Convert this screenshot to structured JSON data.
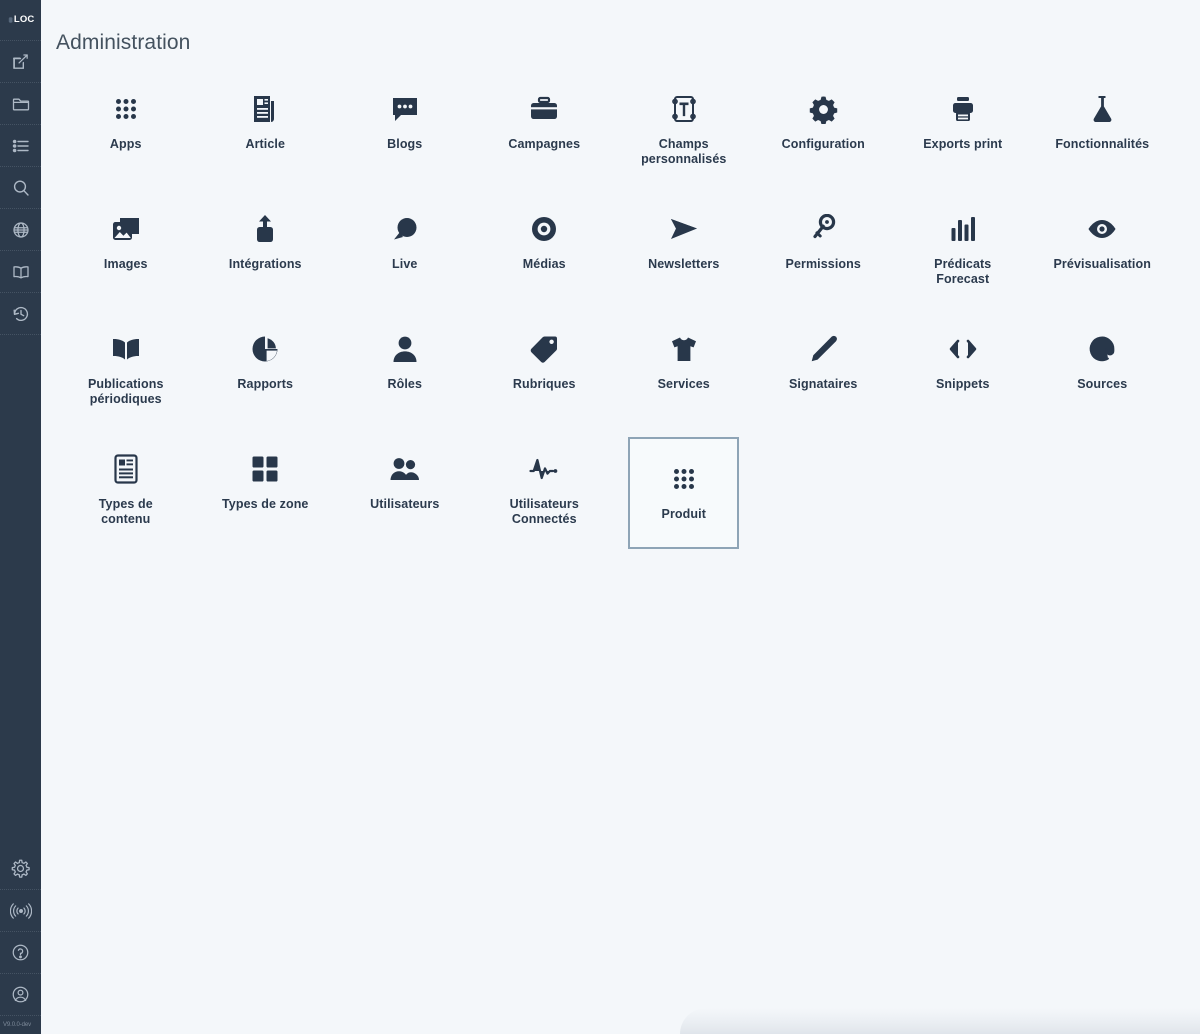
{
  "app": {
    "logo_text": "LOC",
    "version": "V9.0.0-dev"
  },
  "sidebar": {
    "items": [
      {
        "icon": "compose-icon",
        "name": "sidebar-item-compose"
      },
      {
        "icon": "folder-icon",
        "name": "sidebar-item-folder"
      },
      {
        "icon": "list-icon",
        "name": "sidebar-item-list"
      },
      {
        "icon": "search-icon",
        "name": "sidebar-item-search"
      },
      {
        "icon": "globe-icon",
        "name": "sidebar-item-globe"
      },
      {
        "icon": "book-icon",
        "name": "sidebar-item-book"
      },
      {
        "icon": "history-icon",
        "name": "sidebar-item-history"
      }
    ],
    "bottom_items": [
      {
        "icon": "gear-icon",
        "name": "sidebar-item-settings"
      },
      {
        "icon": "broadcast-icon",
        "name": "sidebar-item-broadcast"
      },
      {
        "icon": "help-icon",
        "name": "sidebar-item-help"
      },
      {
        "icon": "account-icon",
        "name": "sidebar-item-account"
      }
    ]
  },
  "page": {
    "title": "Administration"
  },
  "colors": {
    "sidebar_bg": "#2c3a4b",
    "main_bg": "#f4f7fa",
    "icon_dark": "#28374a",
    "label": "#2b3a4d",
    "title": "#44525f",
    "selected_border": "#8ea4b6"
  },
  "tiles": [
    {
      "label": "Apps",
      "icon": "apps-grid-icon",
      "selected": false
    },
    {
      "label": "Article",
      "icon": "article-icon",
      "selected": false
    },
    {
      "label": "Blogs",
      "icon": "chat-bubble-icon",
      "selected": false
    },
    {
      "label": "Campagnes",
      "icon": "briefcase-icon",
      "selected": false
    },
    {
      "label": "Champs\npersonnalisés",
      "icon": "text-field-icon",
      "selected": false
    },
    {
      "label": "Configuration",
      "icon": "gear-icon",
      "selected": false
    },
    {
      "label": "Exports print",
      "icon": "printer-icon",
      "selected": false
    },
    {
      "label": "Fonctionnalités",
      "icon": "flask-icon",
      "selected": false
    },
    {
      "label": "Images",
      "icon": "images-icon",
      "selected": false
    },
    {
      "label": "Intégrations",
      "icon": "upload-box-icon",
      "selected": false
    },
    {
      "label": "Live",
      "icon": "speech-bubble-icon",
      "selected": false
    },
    {
      "label": "Médias",
      "icon": "record-circle-icon",
      "selected": false
    },
    {
      "label": "Newsletters",
      "icon": "send-arrow-icon",
      "selected": false
    },
    {
      "label": "Permissions",
      "icon": "key-icon",
      "selected": false
    },
    {
      "label": "Prédicats\nForecast",
      "icon": "bar-chart-icon",
      "selected": false
    },
    {
      "label": "Prévisualisation",
      "icon": "eye-icon",
      "selected": false
    },
    {
      "label": "Publications\npériodiques",
      "icon": "open-book-icon",
      "selected": false
    },
    {
      "label": "Rapports",
      "icon": "pie-chart-icon",
      "selected": false
    },
    {
      "label": "Rôles",
      "icon": "person-icon",
      "selected": false
    },
    {
      "label": "Rubriques",
      "icon": "tag-icon",
      "selected": false
    },
    {
      "label": "Services",
      "icon": "tshirt-icon",
      "selected": false
    },
    {
      "label": "Signataires",
      "icon": "pencil-icon",
      "selected": false
    },
    {
      "label": "Snippets",
      "icon": "code-brackets-icon",
      "selected": false
    },
    {
      "label": "Sources",
      "icon": "at-sign-icon",
      "selected": false
    },
    {
      "label": "Types de\ncontenu",
      "icon": "content-type-icon",
      "selected": false
    },
    {
      "label": "Types de zone",
      "icon": "zone-squares-icon",
      "selected": false
    },
    {
      "label": "Utilisateurs",
      "icon": "people-icon",
      "selected": false
    },
    {
      "label": "Utilisateurs\nConnectés",
      "icon": "pulse-icon",
      "selected": false
    },
    {
      "label": "Produit",
      "icon": "apps-grid-icon",
      "selected": true
    }
  ]
}
